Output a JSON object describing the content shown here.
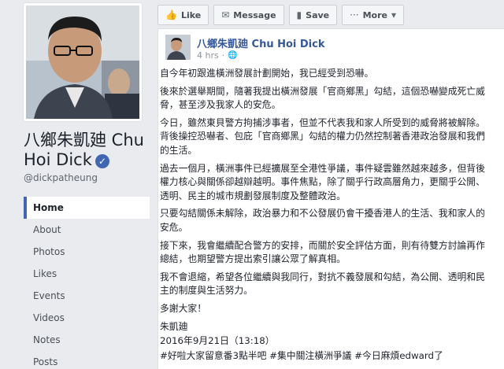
{
  "profile": {
    "name": "八鄉朱凱廸 Chu Hoi Dick",
    "handle": "@dickpatheung",
    "verified_icon": "checkmark-icon"
  },
  "nav": {
    "items": [
      {
        "label": "Home",
        "active": true
      },
      {
        "label": "About",
        "active": false
      },
      {
        "label": "Photos",
        "active": false
      },
      {
        "label": "Likes",
        "active": false
      },
      {
        "label": "Events",
        "active": false
      },
      {
        "label": "Videos",
        "active": false
      },
      {
        "label": "Notes",
        "active": false
      },
      {
        "label": "Posts",
        "active": false
      }
    ]
  },
  "actions": {
    "like": {
      "label": "Like",
      "icon": "thumbs-up-icon"
    },
    "message": {
      "label": "Message",
      "icon": "message-icon"
    },
    "save": {
      "label": "Save",
      "icon": "bookmark-icon"
    },
    "more": {
      "label": "More",
      "icon": "more-dots-icon"
    }
  },
  "post": {
    "author": "八鄉朱凱廸 Chu Hoi Dick",
    "time": "4 hrs",
    "paragraphs": [
      "自今年初跟進橫洲發展計劃開始，我已經受到恐嚇。",
      "後來於選舉期間，隨著我提出橫洲發展「官商鄉黑」勾結，這個恐嚇變成死亡威脅，甚至涉及我家人的安危。",
      "今日，雖然東貝警方拘捕涉事者，但並不代表我和家人所受到的威脅將被解除。背後操控恐嚇者、包庇「官商鄉黑」勾結的權力仍然控制著香港政治發展和我們的生活。",
      "過去一個月，橫洲事件已經擴展至全港性爭議，事件疑雲雖然越來越多，但背後權力核心與關係卻越辯越明。事件焦點，除了關乎行政高層角力，更關乎公開、透明、民主的城市規劃發展制度及整體政治。",
      "只要勾結關係未解除，政治暴力和不公發展仍會干擾香港人的生活、我和家人的安危。",
      "接下來，我會繼續配合警方的安排，而關於安全評估方面，則有待雙方討論再作總結，也期望警方提出索引讓公眾了解真相。",
      "我不會退縮，希望各位繼續與我同行，對抗不義發展和勾結，為公開、透明和民主的制度與生活努力。",
      "多謝大家！"
    ],
    "signature": "朱凱廸",
    "date": "2016年9月21日（13:18）",
    "hashtags": [
      "#好啦大家留意番3點半吧",
      "#集中關注橫洲爭議",
      "#今日麻煩edward了"
    ]
  }
}
